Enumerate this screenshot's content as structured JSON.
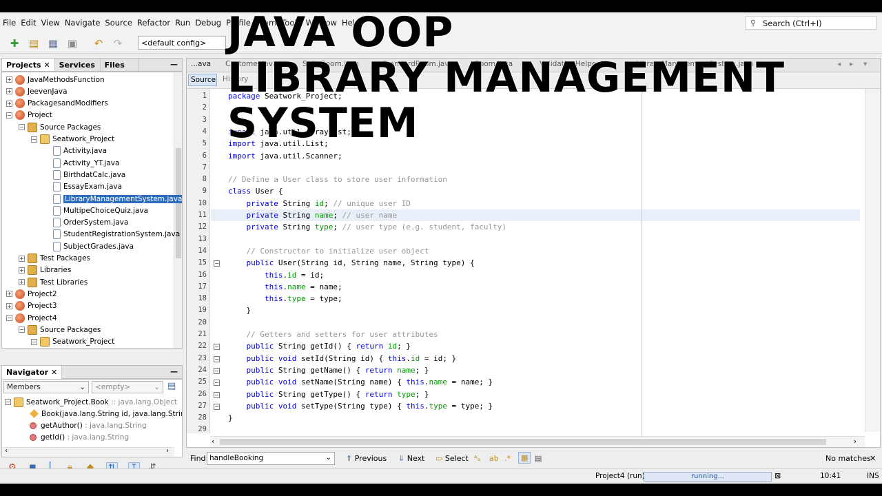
{
  "menu": [
    "File",
    "Edit",
    "View",
    "Navigate",
    "Source",
    "Refactor",
    "Run",
    "Debug",
    "Profile",
    "Team",
    "Tools",
    "Window",
    "Help"
  ],
  "search": {
    "placeholder": "Search (Ctrl+I)"
  },
  "toolbar": {
    "config": "<default config>"
  },
  "panels": {
    "projects": "Projects",
    "services": "Services",
    "files": "Files",
    "navigator": "Navigator"
  },
  "tree": [
    {
      "label": "JavaMethodsFunction",
      "type": "proj",
      "level": 0
    },
    {
      "label": "JeevenJava",
      "type": "proj",
      "level": 0
    },
    {
      "label": "PackagesandModifiers",
      "type": "proj",
      "level": 0
    },
    {
      "label": "Project",
      "type": "proj",
      "level": 0
    },
    {
      "label": "Source Packages",
      "type": "pkgs",
      "level": 1
    },
    {
      "label": "Seatwork_Project",
      "type": "pkg",
      "level": 2
    },
    {
      "label": "Activity.java",
      "type": "file",
      "level": 3
    },
    {
      "label": "Activity_YT.java",
      "type": "file",
      "level": 3
    },
    {
      "label": "BirthdatCalc.java",
      "type": "file",
      "level": 3
    },
    {
      "label": "EssayExam.java",
      "type": "file",
      "level": 3
    },
    {
      "label": "LibraryManagementSystem.java",
      "type": "file",
      "level": 3,
      "selected": true
    },
    {
      "label": "MultipeChoiceQuiz.java",
      "type": "file",
      "level": 3
    },
    {
      "label": "OrderSystem.java",
      "type": "file",
      "level": 3
    },
    {
      "label": "StudentRegistrationSystem.java",
      "type": "file",
      "level": 3
    },
    {
      "label": "SubjectGrades.java",
      "type": "file",
      "level": 3
    },
    {
      "label": "Test Packages",
      "type": "pkgs",
      "level": 1
    },
    {
      "label": "Libraries",
      "type": "pkgs",
      "level": 1
    },
    {
      "label": "Test Libraries",
      "type": "pkgs",
      "level": 1
    },
    {
      "label": "Project2",
      "type": "proj",
      "level": 0
    },
    {
      "label": "Project3",
      "type": "proj",
      "level": 0
    },
    {
      "label": "Project4",
      "type": "proj",
      "level": 0
    },
    {
      "label": "Source Packages",
      "type": "pkgs",
      "level": 1
    },
    {
      "label": "Seatwork_Project",
      "type": "pkg",
      "level": 2
    }
  ],
  "navigator": {
    "members": "Members",
    "filter": "<empty>",
    "class_name": "Seatwork_Project.Book",
    "class_type": ":: java.lang.Object",
    "items": [
      {
        "name": "Book(java.lang.String id, java.lang.String",
        "type": "",
        "kind": "ctor"
      },
      {
        "name": "getAuthor()",
        "type": ": java.lang.String",
        "kind": "method"
      },
      {
        "name": "getId()",
        "type": ": java.lang.String",
        "kind": "method"
      }
    ]
  },
  "editor_tabs": [
    "...ava",
    "Customer.java",
    "SuiteRoom.java",
    "StandardRoom.java",
    "Room.java",
    "ValidationHelper.java",
    "LibraryManagementSystem.java"
  ],
  "editor": {
    "source": "Source",
    "history": "History"
  },
  "code": [
    "package Seatwork_Project;",
    "",
    "",
    "import java.util.ArrayList;",
    "import java.util.List;",
    "import java.util.Scanner;",
    "",
    "// Define a User class to store user information",
    "class User {",
    "    private String id; // unique user ID",
    "    private String name; // user name",
    "    private String type; // user type (e.g. student, faculty)",
    "",
    "    // Constructor to initialize user object",
    "    public User(String id, String name, String type) {",
    "        this.id = id;",
    "        this.name = name;",
    "        this.type = type;",
    "    }",
    "",
    "    // Getters and setters for user attributes",
    "    public String getId() { return id; }",
    "    public void setId(String id) { this.id = id; }",
    "    public String getName() { return name; }",
    "    public void setName(String name) { this.name = name; }",
    "    public String getType() { return type; }",
    "    public void setType(String type) { this.type = type; }",
    "}",
    ""
  ],
  "find": {
    "label": "Find:",
    "value": "handleBooking",
    "previous": "Previous",
    "next": "Next",
    "select": "Select",
    "result": "No matches"
  },
  "status": {
    "project": "Project4 (run)",
    "progress": "running...",
    "time": "10:41",
    "mode": "INS"
  },
  "overlay": {
    "line1": "JAVA OOP",
    "line2": "LIBRARY MANAGEMENT",
    "line3": "SYSTEM"
  }
}
